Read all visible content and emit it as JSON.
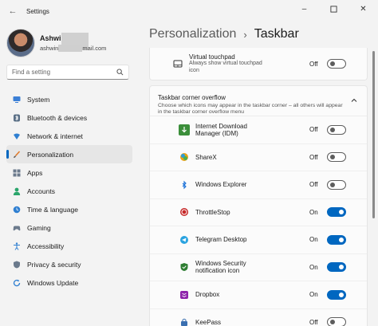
{
  "window": {
    "title": "Settings",
    "back_glyph": "←",
    "minimize_glyph": "–",
    "close_glyph": "✕"
  },
  "profile": {
    "name": "Ashwin",
    "email_prefix": "ashwin",
    "email_suffix": "mail.com"
  },
  "search": {
    "placeholder": "Find a setting"
  },
  "nav": [
    {
      "label": "System",
      "icon": "monitor-icon"
    },
    {
      "label": "Bluetooth & devices",
      "icon": "bluetooth-icon"
    },
    {
      "label": "Network & internet",
      "icon": "wifi-icon"
    },
    {
      "label": "Personalization",
      "icon": "brush-icon",
      "active": true
    },
    {
      "label": "Apps",
      "icon": "apps-icon"
    },
    {
      "label": "Accounts",
      "icon": "person-icon"
    },
    {
      "label": "Time & language",
      "icon": "globe-clock-icon"
    },
    {
      "label": "Gaming",
      "icon": "gamepad-icon"
    },
    {
      "label": "Accessibility",
      "icon": "accessibility-icon"
    },
    {
      "label": "Privacy & security",
      "icon": "shield-icon"
    },
    {
      "label": "Windows Update",
      "icon": "update-icon"
    }
  ],
  "breadcrumb": {
    "parent": "Personalization",
    "separator": "›",
    "current": "Taskbar"
  },
  "virtual_touchpad": {
    "title": "Virtual touchpad",
    "subtitle": "Always show virtual touchpad icon",
    "state": "Off",
    "on": false
  },
  "overflow": {
    "title": "Taskbar corner overflow",
    "description": "Choose which icons may appear in the taskbar corner – all others will appear in the taskbar corner overflow menu",
    "items": [
      {
        "name": "Internet Download Manager (IDM)",
        "state": "Off",
        "on": false,
        "icon": "idm-icon",
        "color": "#3b8e3a"
      },
      {
        "name": "ShareX",
        "state": "Off",
        "on": false,
        "icon": "sharex-icon",
        "color": "#e8a317"
      },
      {
        "name": "Windows Explorer",
        "state": "Off",
        "on": false,
        "icon": "bluetooth-icon",
        "color": "#1e73d8"
      },
      {
        "name": "ThrottleStop",
        "state": "On",
        "on": true,
        "icon": "throttlestop-icon",
        "color": "#c62828"
      },
      {
        "name": "Telegram Desktop",
        "state": "On",
        "on": true,
        "icon": "telegram-icon",
        "color": "#2aa3e0"
      },
      {
        "name": "Windows Security notification icon",
        "state": "On",
        "on": true,
        "icon": "shield-check-icon",
        "color": "#2e7d32"
      },
      {
        "name": "Dropbox",
        "state": "On",
        "on": true,
        "icon": "dropbox-icon",
        "color": "#8e24aa"
      },
      {
        "name": "KeePass",
        "state": "Off",
        "on": false,
        "icon": "keepass-icon",
        "color": "#3a6fb0"
      }
    ]
  }
}
